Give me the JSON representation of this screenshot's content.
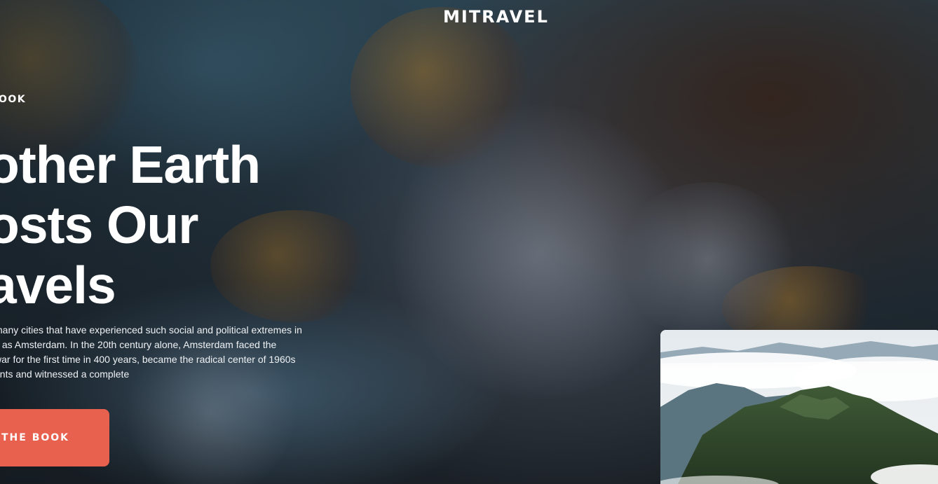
{
  "brand": {
    "name": "MITRAVEL"
  },
  "hero": {
    "eyebrow": "OOK",
    "headline_lines": [
      "other Earth",
      "osts Our",
      "avels"
    ],
    "description_lines": [
      "many cities that have experienced such social and political extremes in",
      "y as Amsterdam. In the 20th century alone, Amsterdam faced the",
      "war for the first time in 400 years, became the radical center of 1960s",
      "ents and witnessed a complete"
    ],
    "cta_label": "THE BOOK"
  },
  "colors": {
    "accent": "#e8614e",
    "text": "#ffffff"
  },
  "images": {
    "background": "aerial-forest-lake-photo",
    "thumbnail": "mountain-clouds-photo"
  }
}
